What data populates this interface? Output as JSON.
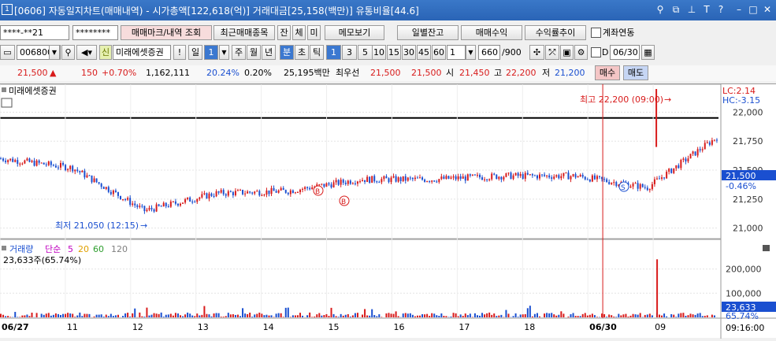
{
  "window": {
    "title": "[0606] 자동일지차트(매매내역) - 시가총액[122,618(억)] 거래대금[25,158(백만)] 유통비율[44.6]",
    "icon_label": "1"
  },
  "toolbar1": {
    "account_value": "****-**21",
    "password_value": "********",
    "trade_mark_button": "매매마크/내역 조회",
    "recent_trades_button": "최근매매종목",
    "tab_jan": "잔",
    "tab_che": "체",
    "tab_mi": "미",
    "memo_button": "메모보기",
    "daily_balance_button": "일별잔고",
    "trade_profit_button": "매매수익",
    "return_trend_button": "수익률추이",
    "account_link_label": "계좌연동"
  },
  "toolbar2": {
    "code_value": "006800",
    "credit_badge": "신",
    "stock_name": "미래에셋증권",
    "alert_label": "!",
    "period_il": "일",
    "period_num": "1",
    "period_ju": "주",
    "period_wol": "월",
    "period_nyeon": "년",
    "period_bun": "분",
    "period_cho": "초",
    "period_tik": "틱",
    "intervals": [
      "1",
      "3",
      "5",
      "10",
      "15",
      "30",
      "45",
      "60"
    ],
    "interval_input": "1",
    "count_value": "660",
    "count_total": "/900",
    "date_check_label": "D",
    "date_value": "06/30"
  },
  "quote": {
    "price": "21,500",
    "change": "150",
    "change_pct": "+0.70%",
    "volume": "1,162,111",
    "turnover_pct": "20.24%",
    "extra_pct": "0.20%",
    "trade_value": "25,195백만",
    "best_label": "최우선",
    "ask": "21,500",
    "bid": "21,500",
    "open_label": "시",
    "open": "21,450",
    "high_label": "고",
    "high": "22,200",
    "low_label": "저",
    "low": "21,200",
    "buy_button": "매수",
    "sell_button": "매도"
  },
  "chart_labels": {
    "stock_legend": "미래에셋증권",
    "lc": "LC:2.14",
    "hc": "HC:-3.15",
    "high_annotation": "최고 22,200 (09:00)",
    "low_annotation": "최저 21,050 (12:15)",
    "current_price_box": "21,500",
    "current_pct_box": "-0.46%",
    "volume_legend": "거래량",
    "ma_label": "단순",
    "ma_periods": [
      "5",
      "20",
      "60",
      "120"
    ],
    "volume_value": "23,633주(65.74%)",
    "vol_box": "23,633",
    "vol_pct": "65.74%",
    "trade_marker_buy": "B",
    "trade_marker_sell": "S",
    "time_label": "09:16:00"
  },
  "chart_data": [
    {
      "type": "candlestick",
      "title": "미래에셋증권",
      "y_ticks": [
        "22,000",
        "21,750",
        "21,500",
        "21,250",
        "21,000"
      ],
      "ylim": [
        20950,
        22200
      ],
      "x_labels": [
        "06/27",
        "11",
        "12",
        "13",
        "14",
        "15",
        "16",
        "17",
        "18",
        "06/30",
        "09"
      ],
      "reference_line": 21950,
      "high": 22200,
      "low": 21050,
      "close": 21500,
      "segments": [
        {
          "x": "06/27",
          "price": 21600
        },
        {
          "x": "11",
          "price": 21520
        },
        {
          "x": "12",
          "price": 21150
        },
        {
          "x": "13",
          "price": 21300
        },
        {
          "x": "14",
          "price": 21320
        },
        {
          "x": "15",
          "price": 21420
        },
        {
          "x": "16",
          "price": 21420
        },
        {
          "x": "17",
          "price": 21450
        },
        {
          "x": "18",
          "price": 21450
        },
        {
          "x": "06/30",
          "price": 21350
        },
        {
          "x": "09",
          "price": 21800
        }
      ]
    },
    {
      "type": "bar",
      "title": "거래량",
      "y_ticks": [
        "200,000",
        "100,000"
      ],
      "ylim": [
        0,
        280000
      ],
      "peak_value": 240000,
      "current_value": 23633
    }
  ],
  "colors": {
    "up": "#d81b1b",
    "down": "#1a4fd0",
    "accent": "#2a64b6",
    "ma5": "#c000c0",
    "ma20": "#e0a000",
    "ma60": "#2e9e2e",
    "ma120": "#808080"
  }
}
